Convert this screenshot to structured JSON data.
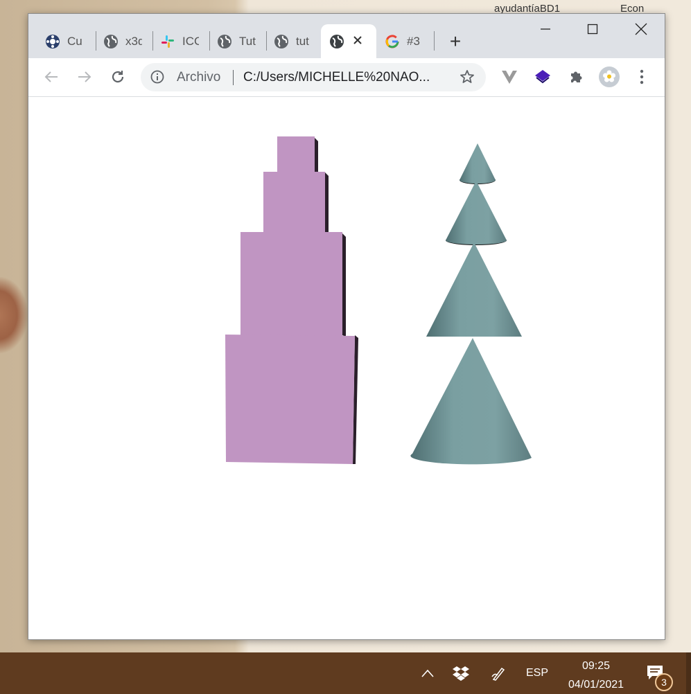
{
  "desktop": {
    "top_right_text_1": "ayudantíaBD1",
    "top_right_text_2": "Econ"
  },
  "browser": {
    "tabs": [
      {
        "label": "Cu",
        "icon": "unity-icon"
      },
      {
        "label": "x3d",
        "icon": "globe-icon"
      },
      {
        "label": "ICC",
        "icon": "slack-icon"
      },
      {
        "label": "Tut",
        "icon": "globe-icon"
      },
      {
        "label": "tut",
        "icon": "globe-icon"
      },
      {
        "label": "",
        "icon": "globe-icon",
        "active": true
      },
      {
        "label": "#3",
        "icon": "google-icon"
      }
    ],
    "new_tab": "+",
    "omnibox": {
      "security_label": "Archivo",
      "url": "C:/Users/MICHELLE%20NAO..."
    }
  },
  "scene": {
    "tower_color": "#c095c2",
    "cones_color": "#7a9fa1"
  },
  "taskbar": {
    "language": "ESP",
    "time": "09:25",
    "date": "04/01/2021",
    "notifications_count": "3",
    "taskbar_color": "#5f3b1f"
  }
}
